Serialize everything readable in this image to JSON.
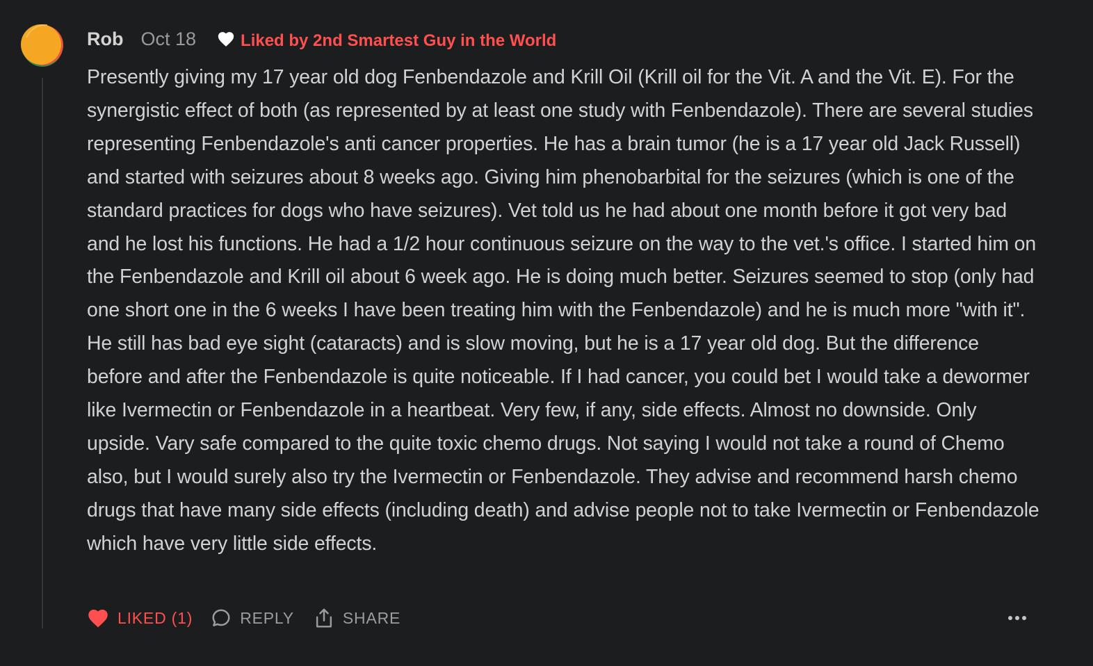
{
  "comment": {
    "author": "Rob",
    "date": "Oct 18",
    "liked_by": "Liked by 2nd Smartest Guy in the World",
    "paragraph": "Presently giving my 17 year old dog Fenbendazole and Krill Oil (Krill oil for the Vit. A and the Vit. E). For the synergistic effect of both (as represented by at least one study with Fenbendazole). There are several studies representing Fenbendazole's anti cancer properties. He has a brain tumor (he is a 17 year old Jack Russell) and started with seizures about 8 weeks ago. Giving him phenobarbital for the seizures (which is one of the standard practices for dogs who have seizures). Vet told us he had about one month before it got very bad and he lost his functions. He had a 1/2 hour continuous seizure on the way to the vet.'s office. I started him on the Fenbendazole and Krill oil about 6 week ago. He is doing much better. Seizures seemed to stop (only had one short one in the 6 weeks I have been treating him with the Fenbendazole) and he is much more \"with it\". He still has bad eye sight (cataracts) and is slow moving, but he is a 17 year old dog. But the difference before and after the Fenbendazole is quite noticeable. If I had cancer, you could bet I would take a dewormer like Ivermectin or Fenbendazole in a heartbeat. Very few, if any, side effects. Almost no downside. Only upside. Vary safe compared to the quite toxic chemo drugs. Not saying I would not take a round of Chemo also, but I would surely also try the Ivermectin or Fenbendazole. They advise and recommend harsh chemo drugs that have many side effects (including death) and advise people not to take Ivermectin or Fenbendazole which have very little side effects."
  },
  "actions": {
    "like_label": "LIKED (1)",
    "reply_label": "REPLY",
    "share_label": "SHARE"
  },
  "icons": {
    "avatar": "avatar-orange-circle",
    "liked_by": "heart-icon",
    "like": "heart-filled-icon",
    "reply": "speech-bubble-icon",
    "share": "share-upload-icon",
    "more": "ellipsis-icon"
  },
  "colors": {
    "background": "#1c1d1f",
    "accent_red": "#ff4f4f",
    "body_text": "#d2d2d2",
    "muted_text": "#9c9c9c",
    "avatar_orange": "#f5a623",
    "avatar_green": "#2e8b57",
    "avatar_red": "#e8553a"
  }
}
